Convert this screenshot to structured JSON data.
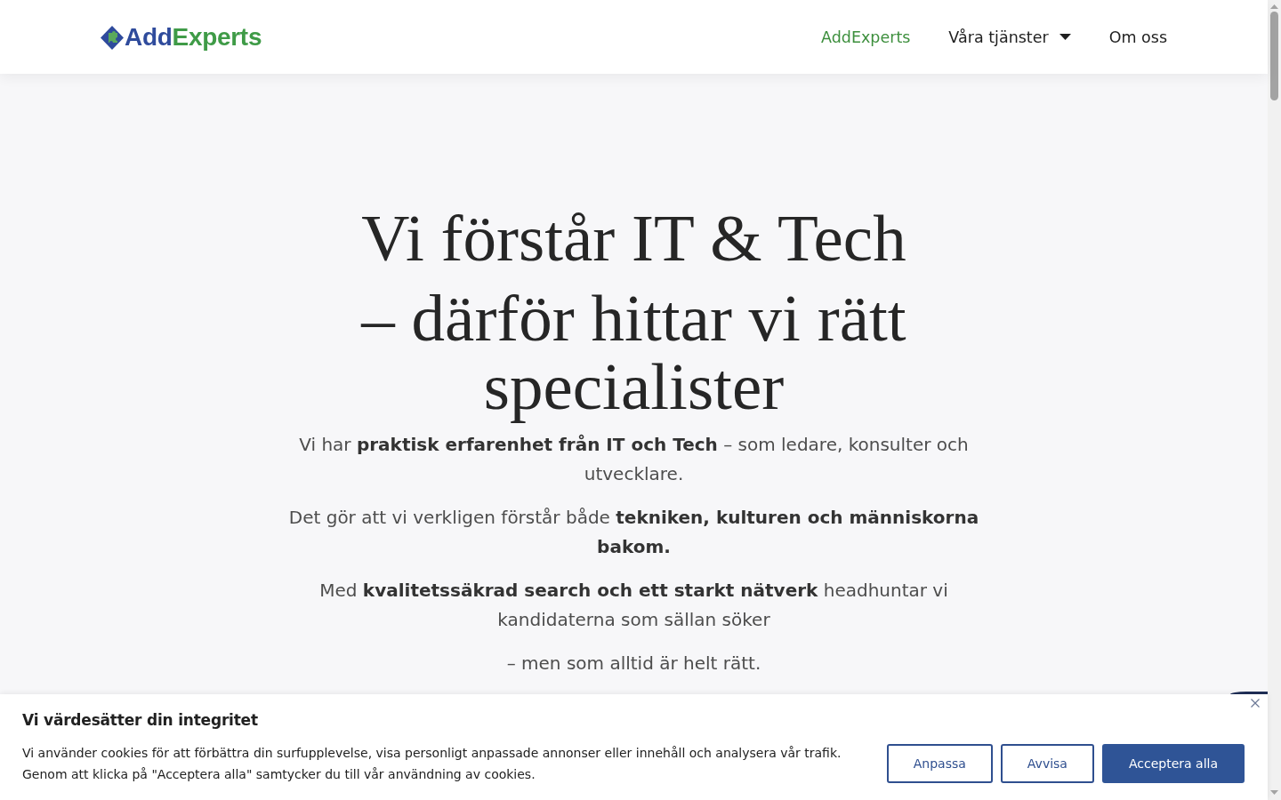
{
  "header": {
    "logo": {
      "first": "Add",
      "second": "Experts"
    },
    "nav": [
      {
        "label": "AddExperts",
        "selected": true,
        "kind": "link"
      },
      {
        "label": "Våra tjänster",
        "selected": false,
        "kind": "dropdown"
      },
      {
        "label": "Om oss",
        "selected": false,
        "kind": "link"
      }
    ]
  },
  "hero": {
    "title_lines": [
      "Vi förstår IT & Tech",
      "– därför hittar vi rätt specialister"
    ],
    "paragraphs": [
      "Vi har **praktisk erfarenhet från IT och Tech** – som ledare, konsulter och utvecklare.",
      "Det gör att vi verkligen förstår både **tekniken, kulturen och människorna bakom.**",
      "Med **kvalitetssäkrad search och ett starkt nätverk** headhuntar vi kandidaterna som sällan söker",
      "– men som alltid är helt rätt."
    ]
  },
  "cookie_banner": {
    "title": "Vi värdesätter din integritet",
    "text": "Vi använder cookies för att förbättra din surfupplevelse, visa personligt anpassade annonser eller innehåll och analysera vår trafik. Genom att klicka på \"Acceptera alla\" samtycker du till vår användning av cookies.",
    "buttons": [
      {
        "label": "Anpassa",
        "kind": "outline"
      },
      {
        "label": "Avvisa",
        "kind": "outline"
      },
      {
        "label": "Acceptera alla",
        "kind": "primary"
      }
    ]
  }
}
